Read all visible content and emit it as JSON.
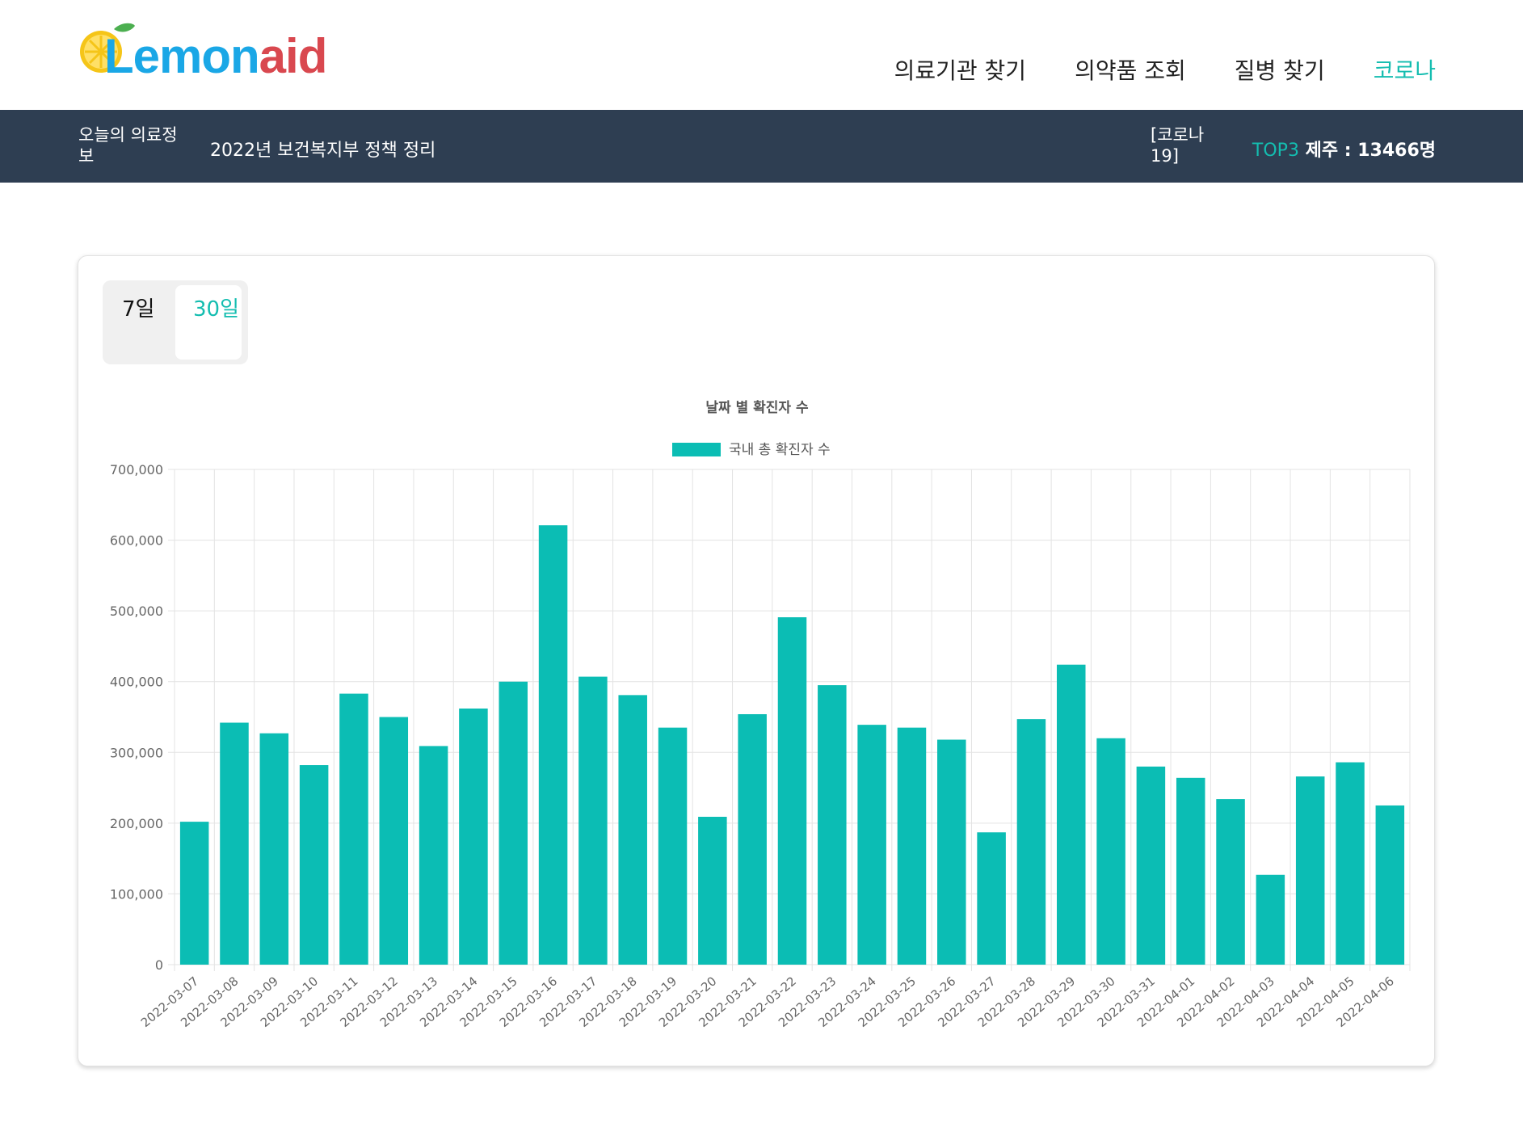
{
  "header": {
    "logo": {
      "lemon": "Lemon",
      "aid": "aid"
    },
    "nav": [
      {
        "label": "의료기관 찾기",
        "active": false
      },
      {
        "label": "의약품 조회",
        "active": false
      },
      {
        "label": "질병 찾기",
        "active": false
      },
      {
        "label": "코로나",
        "active": true
      }
    ]
  },
  "infobar": {
    "label": "오늘의 의료정보",
    "link": "2022년 보건복지부 정책 정리",
    "corona_label": "[코로나 19]",
    "top3_tag": "TOP3",
    "top3_value": "제주 : 13466명"
  },
  "toggle": {
    "option_7": "7일",
    "option_30": "30일",
    "selected": "30일"
  },
  "colors": {
    "accent": "#14bdb0",
    "bar": "#0bbdb4",
    "infobar_bg": "#2e3e52"
  },
  "chart_data": {
    "type": "bar",
    "title": "날짜 별 확진자 수",
    "legend": "top",
    "ylim": [
      0,
      700000
    ],
    "yticks": [
      "700,000",
      "600,000",
      "500,000",
      "400,000",
      "300,000",
      "200,000",
      "100,000",
      "0"
    ],
    "grid": true,
    "categories": [
      "2022-03-07",
      "2022-03-08",
      "2022-03-09",
      "2022-03-10",
      "2022-03-11",
      "2022-03-12",
      "2022-03-13",
      "2022-03-14",
      "2022-03-15",
      "2022-03-16",
      "2022-03-17",
      "2022-03-18",
      "2022-03-19",
      "2022-03-20",
      "2022-03-21",
      "2022-03-22",
      "2022-03-23",
      "2022-03-24",
      "2022-03-25",
      "2022-03-26",
      "2022-03-27",
      "2022-03-28",
      "2022-03-29",
      "2022-03-30",
      "2022-03-31",
      "2022-04-01",
      "2022-04-02",
      "2022-04-03",
      "2022-04-04",
      "2022-04-05",
      "2022-04-06"
    ],
    "series": [
      {
        "name": "국내 총 확진자 수",
        "values": [
          202000,
          342000,
          327000,
          282000,
          383000,
          350000,
          309000,
          362000,
          400000,
          621000,
          407000,
          381000,
          335000,
          209000,
          354000,
          491000,
          395000,
          339000,
          335000,
          318000,
          187000,
          347000,
          424000,
          320000,
          280000,
          264000,
          234000,
          127000,
          266000,
          286000,
          225000
        ]
      }
    ]
  }
}
